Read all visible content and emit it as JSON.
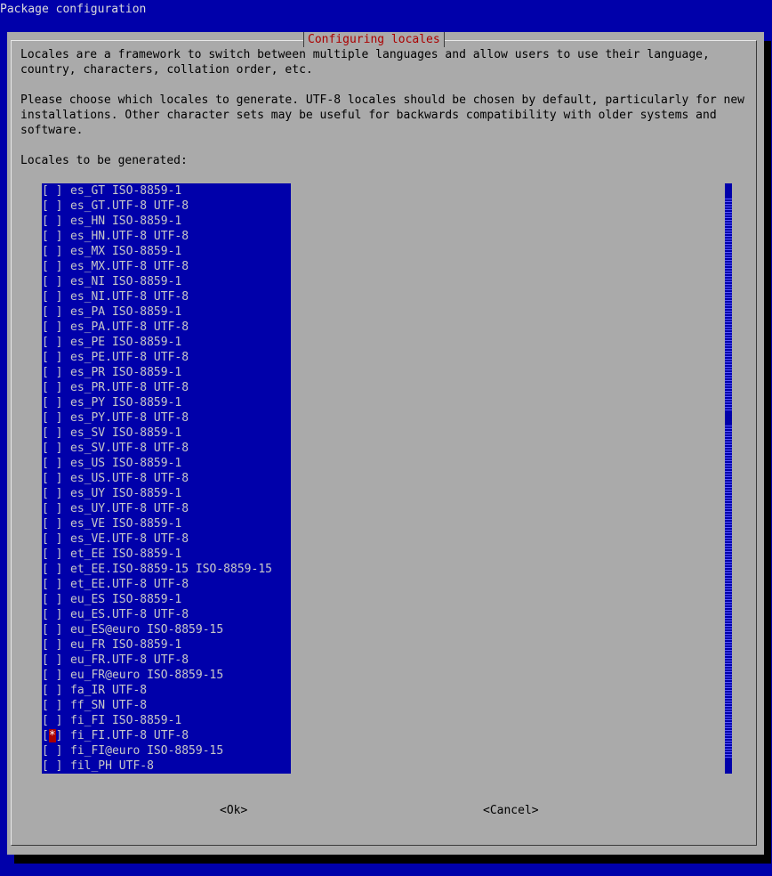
{
  "backtitle": "Package configuration",
  "dialog": {
    "title": "Configuring locales",
    "paragraph1": "Locales are a framework to switch between multiple languages and allow users to use their language, country, characters, collation order, etc.",
    "paragraph2": "Please choose which locales to generate. UTF-8 locales should be chosen by default, particularly for new installations. Other character sets may be useful for backwards compatibility with older systems and software.",
    "list_label": "Locales to be generated:"
  },
  "locales": [
    {
      "label": "es_GT ISO-8859-1",
      "checked": false
    },
    {
      "label": "es_GT.UTF-8 UTF-8",
      "checked": false
    },
    {
      "label": "es_HN ISO-8859-1",
      "checked": false
    },
    {
      "label": "es_HN.UTF-8 UTF-8",
      "checked": false
    },
    {
      "label": "es_MX ISO-8859-1",
      "checked": false
    },
    {
      "label": "es_MX.UTF-8 UTF-8",
      "checked": false
    },
    {
      "label": "es_NI ISO-8859-1",
      "checked": false
    },
    {
      "label": "es_NI.UTF-8 UTF-8",
      "checked": false
    },
    {
      "label": "es_PA ISO-8859-1",
      "checked": false
    },
    {
      "label": "es_PA.UTF-8 UTF-8",
      "checked": false
    },
    {
      "label": "es_PE ISO-8859-1",
      "checked": false
    },
    {
      "label": "es_PE.UTF-8 UTF-8",
      "checked": false
    },
    {
      "label": "es_PR ISO-8859-1",
      "checked": false
    },
    {
      "label": "es_PR.UTF-8 UTF-8",
      "checked": false
    },
    {
      "label": "es_PY ISO-8859-1",
      "checked": false
    },
    {
      "label": "es_PY.UTF-8 UTF-8",
      "checked": false
    },
    {
      "label": "es_SV ISO-8859-1",
      "checked": false
    },
    {
      "label": "es_SV.UTF-8 UTF-8",
      "checked": false
    },
    {
      "label": "es_US ISO-8859-1",
      "checked": false
    },
    {
      "label": "es_US.UTF-8 UTF-8",
      "checked": false
    },
    {
      "label": "es_UY ISO-8859-1",
      "checked": false
    },
    {
      "label": "es_UY.UTF-8 UTF-8",
      "checked": false
    },
    {
      "label": "es_VE ISO-8859-1",
      "checked": false
    },
    {
      "label": "es_VE.UTF-8 UTF-8",
      "checked": false
    },
    {
      "label": "et_EE ISO-8859-1",
      "checked": false
    },
    {
      "label": "et_EE.ISO-8859-15 ISO-8859-15",
      "checked": false
    },
    {
      "label": "et_EE.UTF-8 UTF-8",
      "checked": false
    },
    {
      "label": "eu_ES ISO-8859-1",
      "checked": false
    },
    {
      "label": "eu_ES.UTF-8 UTF-8",
      "checked": false
    },
    {
      "label": "eu_ES@euro ISO-8859-15",
      "checked": false
    },
    {
      "label": "eu_FR ISO-8859-1",
      "checked": false
    },
    {
      "label": "eu_FR.UTF-8 UTF-8",
      "checked": false
    },
    {
      "label": "eu_FR@euro ISO-8859-15",
      "checked": false
    },
    {
      "label": "fa_IR UTF-8",
      "checked": false
    },
    {
      "label": "ff_SN UTF-8",
      "checked": false
    },
    {
      "label": "fi_FI ISO-8859-1",
      "checked": false
    },
    {
      "label": "fi_FI.UTF-8 UTF-8",
      "checked": true,
      "focused": true
    },
    {
      "label": "fi_FI@euro ISO-8859-15",
      "checked": false
    },
    {
      "label": "fil_PH UTF-8",
      "checked": false
    }
  ],
  "checkbox": {
    "open": "[",
    "close": "]",
    "mark": "*",
    "empty": " "
  },
  "buttons": {
    "ok": "<Ok>",
    "cancel": "<Cancel>"
  },
  "colors": {
    "screen": "#0000aa",
    "dialog": "#aaaaaa",
    "title": "#aa0000",
    "focus_mark": "#aa0000"
  }
}
